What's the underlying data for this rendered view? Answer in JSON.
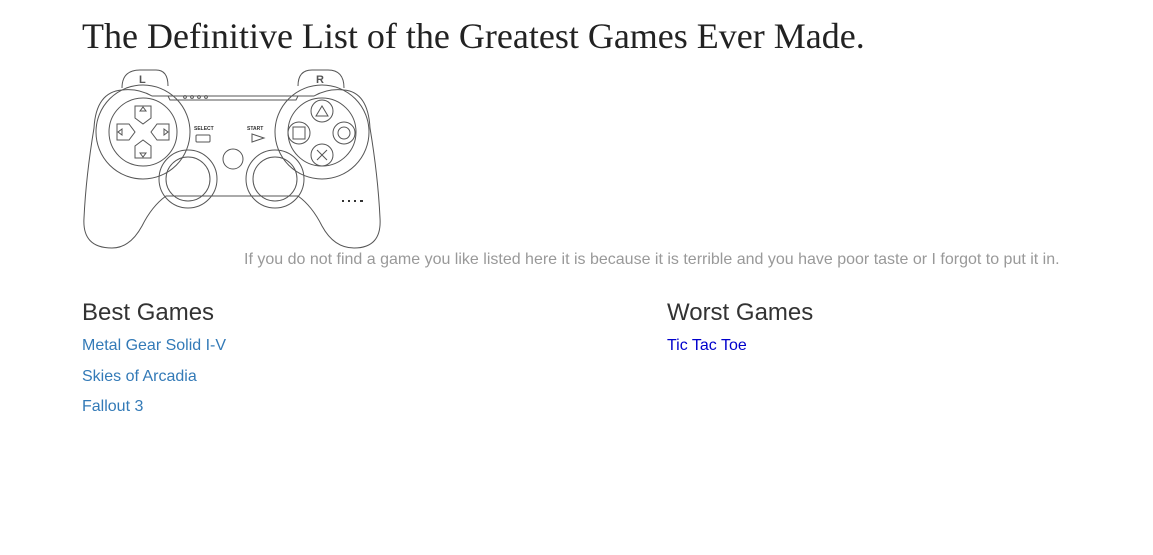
{
  "page": {
    "title": "The Definitive List of the Greatest Games Ever Made.",
    "tagline": "If you do not find a game you like listed here it is because it is terrible and you have poor taste or I forgot to put it in."
  },
  "controller": {
    "icon": "game-controller-icon",
    "shoulder_left": "L",
    "shoulder_right": "R",
    "select_label": "SELECT",
    "start_label": "START"
  },
  "best": {
    "heading": "Best Games",
    "items": [
      {
        "label": "Metal Gear Solid I-V"
      },
      {
        "label": "Skies of Arcadia"
      },
      {
        "label": "Fallout 3"
      }
    ]
  },
  "worst": {
    "heading": "Worst Games",
    "items": [
      {
        "label": "Tic Tac Toe"
      }
    ]
  },
  "colors": {
    "link_best": "#337ab7",
    "link_worst": "#0000cc",
    "tagline": "#999999",
    "heading": "#333333"
  }
}
